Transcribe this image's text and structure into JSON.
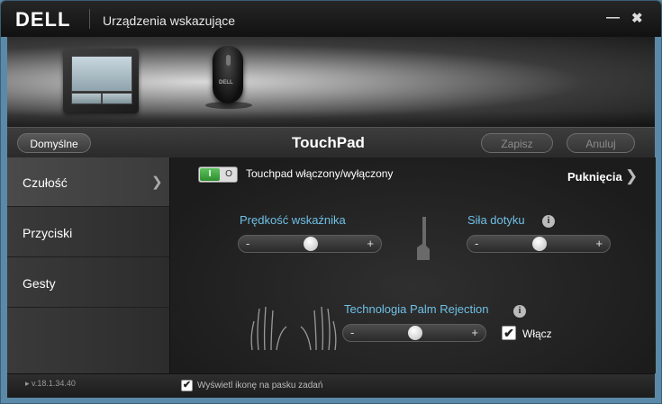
{
  "window": {
    "brand": "DELL",
    "title": "Urządzenia wskazujące",
    "minimize_glyph": "—",
    "close_glyph": "✖"
  },
  "hero": {
    "devices": [
      {
        "name": "touchpad",
        "icon": "touchpad-icon"
      },
      {
        "name": "mouse",
        "icon": "mouse-icon",
        "logo": "DELL"
      }
    ]
  },
  "toolbar": {
    "default_label": "Domyślne",
    "panel_title": "TouchPad",
    "save_label": "Zapisz",
    "cancel_label": "Anuluj"
  },
  "sidebar": {
    "items": [
      {
        "label": "Czułość",
        "active": true
      },
      {
        "label": "Przyciski",
        "active": false
      },
      {
        "label": "Gesty",
        "active": false
      }
    ]
  },
  "content": {
    "toggle": {
      "on_text": "I",
      "off_text": "O",
      "state": "on",
      "label": "Touchpad włączony/wyłączony"
    },
    "taps_link": "Puknięcia",
    "pointer_speed": {
      "label": "Prędkość wskaźnika",
      "minus": "-",
      "plus": "+",
      "value_percent": 50
    },
    "touch_force": {
      "label": "Siła dotyku",
      "minus": "-",
      "plus": "+",
      "value_percent": 50,
      "info": "i"
    },
    "palm_rejection": {
      "label": "Technologia Palm Rejection",
      "minus": "-",
      "plus": "+",
      "value_percent": 50,
      "info": "i",
      "enable_label": "Włącz",
      "enabled": true,
      "check_glyph": "✔"
    }
  },
  "statusbar": {
    "version": "v.18.1.34.40",
    "tray_icon_label": "Wyświetl ikonę na pasku zadań",
    "tray_icon_checked": true,
    "check_glyph": "✔",
    "arrow_glyph": "▸"
  }
}
